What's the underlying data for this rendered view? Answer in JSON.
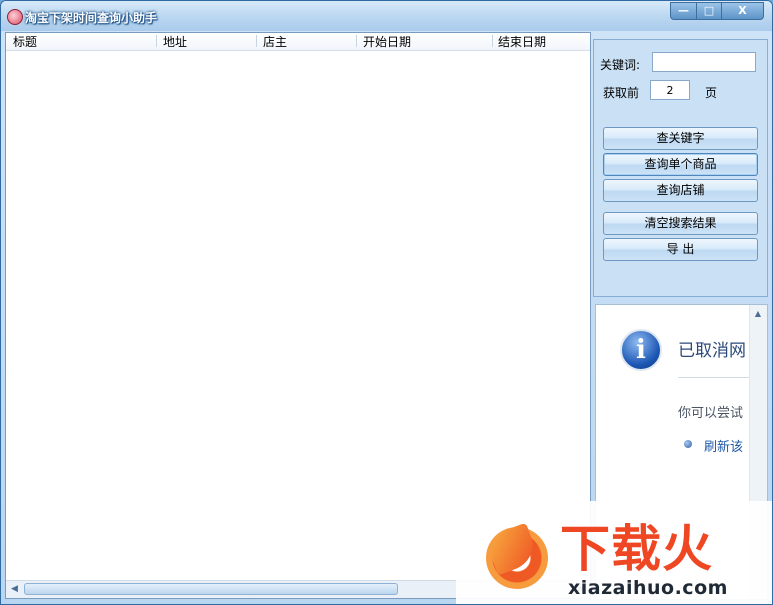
{
  "window": {
    "title": "淘宝下架时间查询小助手",
    "minimize_glyph": "—",
    "maximize_glyph": "□",
    "close_glyph": "X"
  },
  "list": {
    "columns": [
      "标题",
      "地址",
      "店主",
      "开始日期",
      "结束日期"
    ],
    "rows": []
  },
  "panel": {
    "keyword_label": "关键词:",
    "keyword_value": "",
    "pages_label": "获取前",
    "pages_value": "2",
    "pages_unit": "页",
    "buttons": [
      "查关键字",
      "查询单个商品",
      "查询店铺",
      "清空搜索结果",
      "导 出"
    ]
  },
  "browser": {
    "title": "已取消网",
    "line": "你可以尝试",
    "link": "刷新该"
  },
  "watermark": {
    "brand": "下载火",
    "url": "xiazaihuo.com"
  }
}
